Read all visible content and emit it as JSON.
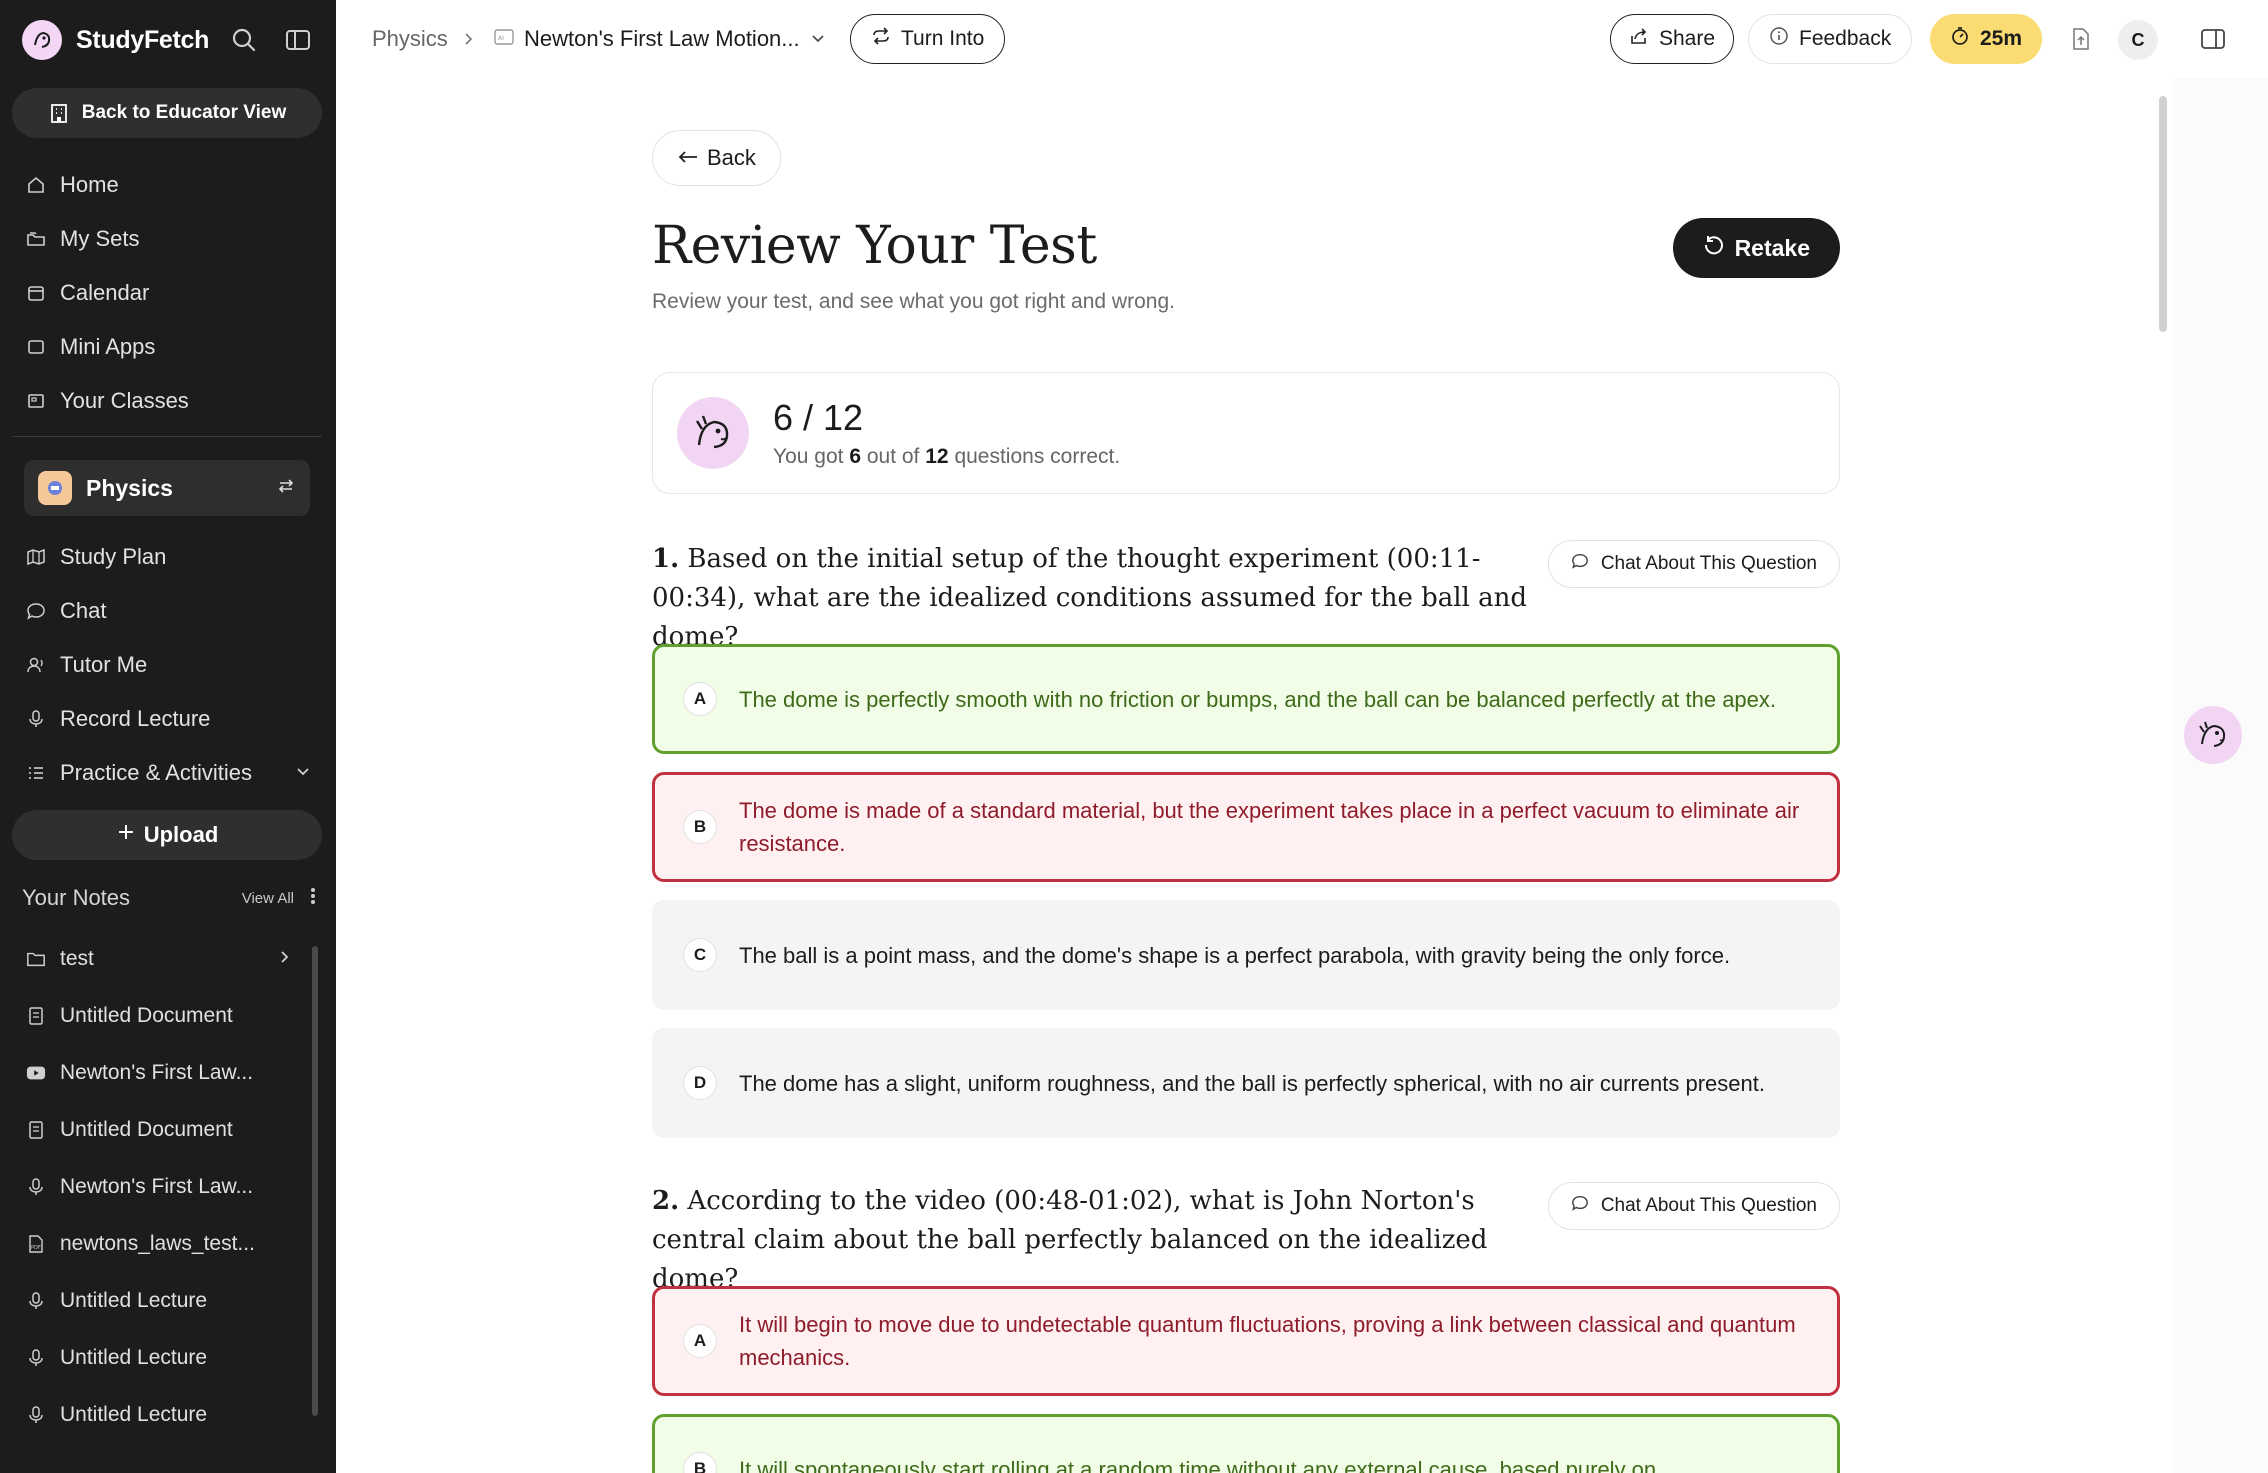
{
  "sidebar": {
    "brand": "StudyFetch",
    "educator_button": "Back to Educator View",
    "nav": [
      {
        "label": "Home",
        "icon": "home-icon"
      },
      {
        "label": "My Sets",
        "icon": "folders-icon"
      },
      {
        "label": "Calendar",
        "icon": "calendar-icon"
      },
      {
        "label": "Mini Apps",
        "icon": "app-window-icon"
      },
      {
        "label": "Your Classes",
        "icon": "classes-icon"
      }
    ],
    "class_selector": {
      "name": "Physics"
    },
    "class_nav": [
      {
        "label": "Study Plan",
        "icon": "map-icon"
      },
      {
        "label": "Chat",
        "icon": "chat-icon"
      },
      {
        "label": "Tutor Me",
        "icon": "tutor-icon"
      },
      {
        "label": "Record Lecture",
        "icon": "microphone-icon"
      },
      {
        "label": "Practice & Activities",
        "icon": "list-icon"
      }
    ],
    "upload_label": "Upload",
    "notes_title": "Your Notes",
    "view_all": "View All",
    "notes": [
      {
        "label": "test",
        "icon": "folder-icon"
      },
      {
        "label": "Untitled Document",
        "icon": "document-icon"
      },
      {
        "label": "Newton's First Law...",
        "icon": "youtube-icon"
      },
      {
        "label": "Untitled Document",
        "icon": "document-icon"
      },
      {
        "label": "Newton's First Law...",
        "icon": "microphone-icon"
      },
      {
        "label": "newtons_laws_test...",
        "icon": "pdf-icon"
      },
      {
        "label": "Untitled Lecture",
        "icon": "microphone-icon"
      },
      {
        "label": "Untitled Lecture",
        "icon": "microphone-icon"
      },
      {
        "label": "Untitled Lecture",
        "icon": "microphone-icon"
      }
    ]
  },
  "topbar": {
    "breadcrumb_root": "Physics",
    "breadcrumb_doc": "Newton's First Law Motion...",
    "turn_into": "Turn Into",
    "share": "Share",
    "feedback": "Feedback",
    "timer": "25m",
    "avatar_initial": "C"
  },
  "main": {
    "back": "Back",
    "title": "Review Your Test",
    "subtitle": "Review your test, and see what you got right and wrong.",
    "retake": "Retake",
    "score": {
      "fraction": "6 / 12",
      "prefix": "You got",
      "correct": "6",
      "middle": "out of",
      "total": "12",
      "suffix": "questions correct."
    },
    "chat_button": "Chat About This Question",
    "questions": [
      {
        "number": "1.",
        "text": "Based on the initial setup of the thought experiment (00:11-00:34), what are the idealized conditions assumed for the ball and dome?",
        "options": [
          {
            "letter": "A",
            "text": "The dome is perfectly smooth with no friction or bumps, and the ball can be balanced perfectly at the apex.",
            "status": "correct"
          },
          {
            "letter": "B",
            "text": "The dome is made of a standard material, but the experiment takes place in a perfect vacuum to eliminate air resistance.",
            "status": "wrong"
          },
          {
            "letter": "C",
            "text": "The ball is a point mass, and the dome's shape is a perfect parabola, with gravity being the only force.",
            "status": "neutral"
          },
          {
            "letter": "D",
            "text": "The dome has a slight, uniform roughness, and the ball is perfectly spherical, with no air currents present.",
            "status": "neutral"
          }
        ]
      },
      {
        "number": "2.",
        "text": "According to the video (00:48-01:02), what is John Norton's central claim about the ball perfectly balanced on the idealized dome?",
        "options": [
          {
            "letter": "A",
            "text": "It will begin to move due to undetectable quantum fluctuations, proving a link between classical and quantum mechanics.",
            "status": "wrong"
          },
          {
            "letter": "B",
            "text": "It will spontaneously start rolling at a random time without any external cause, based purely on",
            "status": "correct"
          }
        ]
      }
    ]
  }
}
